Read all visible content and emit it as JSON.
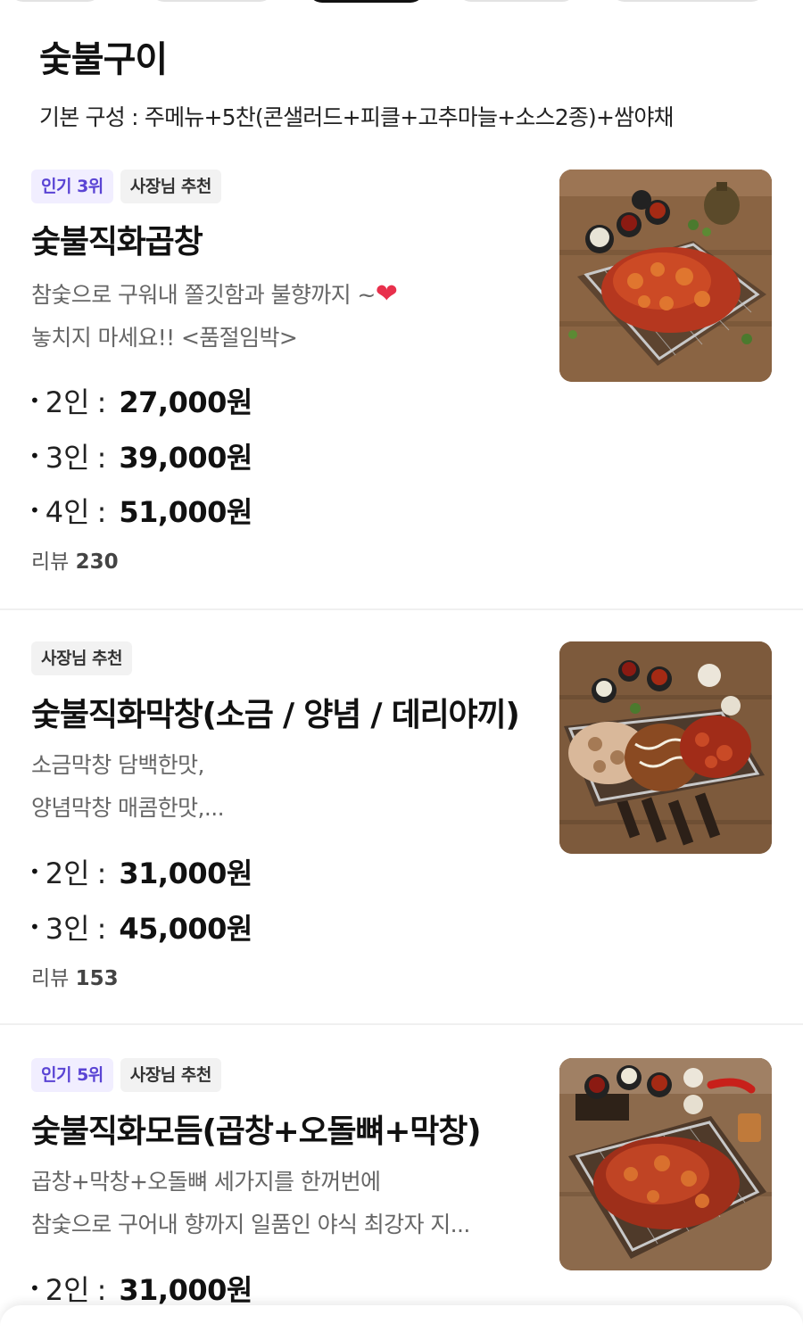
{
  "category": {
    "title": "숯불구이",
    "description": "기본 구성 : 주메뉴+5찬(콘샐러드+피클+고추마늘+소스2종)+쌈야채"
  },
  "items": [
    {
      "badges": [
        "인기 3위",
        "사장님 추천"
      ],
      "name": "숯불직화곱창",
      "desc_lines": [
        "참숯으로 구워내 쫄깃함과 불향까지 ~",
        "놓치지 마세요!! <품절임박>"
      ],
      "prices": [
        {
          "label": "2인",
          "value": "27,000원"
        },
        {
          "label": "3인",
          "value": "39,000원"
        },
        {
          "label": "4인",
          "value": "51,000원"
        }
      ],
      "review_label": "리뷰",
      "review_count": "230"
    },
    {
      "badges": [
        "사장님 추천"
      ],
      "name": "숯불직화막창(소금 / 양념 / 데리야끼)",
      "desc_lines": [
        "소금막창 담백한맛,",
        "양념막창 매콤한맛,..."
      ],
      "prices": [
        {
          "label": "2인",
          "value": "31,000원"
        },
        {
          "label": "3인",
          "value": "45,000원"
        }
      ],
      "review_label": "리뷰",
      "review_count": "153"
    },
    {
      "badges": [
        "인기 5위",
        "사장님 추천"
      ],
      "name": "숯불직화모듬(곱창+오돌뼈+막창)",
      "desc_lines": [
        "곱창+막창+오돌뼈 세가지를 한꺼번에",
        "참숯으로 구어내 향까지 일품인 야식 최강자  지..."
      ],
      "prices": [
        {
          "label": "2인",
          "value": "31,000원"
        }
      ]
    }
  ],
  "icons": {
    "bullet": "•",
    "heart": "heart-icon"
  },
  "colors": {
    "rank_badge": "#5a44d4",
    "heart": "#e8304c"
  }
}
